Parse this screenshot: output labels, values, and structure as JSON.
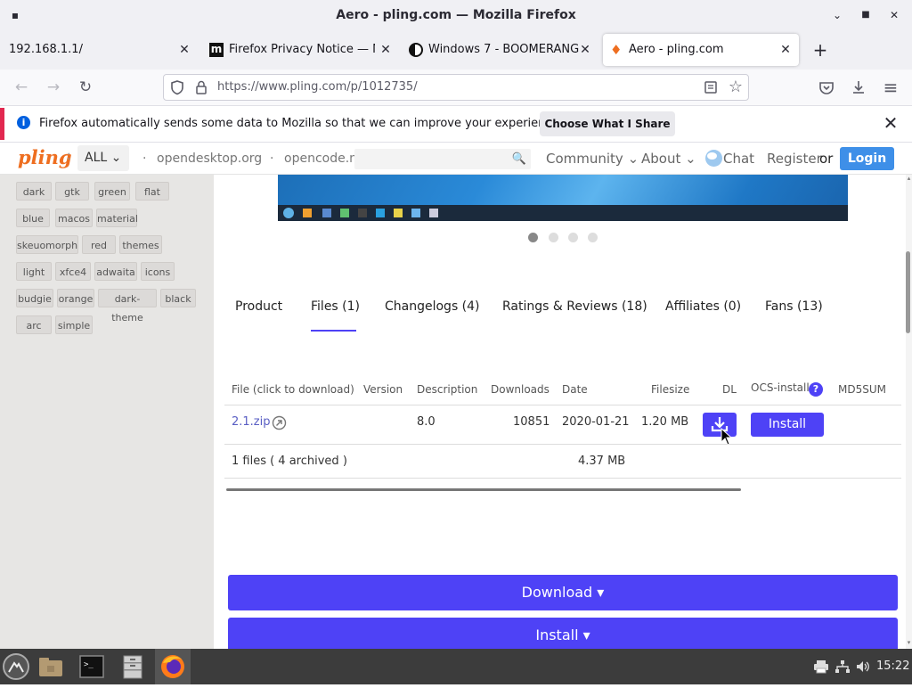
{
  "window": {
    "title": "Aero - pling.com — Mozilla Firefox",
    "min": "▪",
    "max": "▪",
    "close": "✕"
  },
  "tabs": [
    {
      "label": "192.168.1.1/",
      "close": "✕"
    },
    {
      "label": "Firefox Privacy Notice — Mo",
      "icon_text": "m",
      "close": "✕"
    },
    {
      "label": "Windows 7 - BOOMERANG",
      "close": "✕"
    },
    {
      "label": "Aero - pling.com",
      "close": "✕"
    }
  ],
  "new_tab": "+",
  "nav": {
    "back": "←",
    "forward": "→",
    "reload": "↻",
    "url": "https://www.pling.com/p/1012735/",
    "menu": "≡"
  },
  "notification": {
    "text": "Firefox automatically sends some data to Mozilla so that we can improve your experience.",
    "button": "Choose What I Share",
    "close": "✕",
    "info": "i"
  },
  "site_header": {
    "logo": "pling",
    "logo_sep": ":",
    "all": "ALL ⌄",
    "links": [
      "opendesktop.org",
      "opencode.ne"
    ],
    "search_value": "",
    "menu": [
      "Community ⌄",
      "About ⌄",
      "Chat"
    ],
    "register": "Register",
    "or": "or",
    "login": "Login"
  },
  "sidebar": {
    "tags": [
      [
        "dark",
        "gtk",
        "green",
        "flat"
      ],
      [
        "blue",
        "macos",
        "material"
      ],
      [
        "skeuomorph",
        "red",
        "themes"
      ],
      [
        "light",
        "xfce4",
        "adwaita",
        "icons"
      ],
      [
        "budgie",
        "orange",
        "dark-theme",
        "black"
      ],
      [
        "arc",
        "simple"
      ]
    ]
  },
  "product_tabs": [
    "Product",
    "Files (1)",
    "Changelogs (4)",
    "Ratings & Reviews (18)",
    "Affiliates (0)",
    "Fans (13)"
  ],
  "files_table": {
    "headers": [
      "File (click to download)",
      "Version",
      "Description",
      "Downloads",
      "Date",
      "Filesize",
      "DL",
      "OCS-install",
      "MD5SUM"
    ],
    "rows": [
      {
        "file": "2.1.zip",
        "version": "",
        "description": "8.0",
        "downloads": "10851",
        "date": "2020-01-21",
        "filesize": "1.20 MB",
        "install": "Install"
      }
    ],
    "summary": {
      "files": "1 files ( 4 archived )",
      "size": "4.37 MB"
    }
  },
  "actions": {
    "download": "Download ▾",
    "install": "Install ▾"
  },
  "taskbar": {
    "clock": "15:22"
  },
  "colors": {
    "accent": "#4e42f6",
    "login": "#3e8fe8",
    "logo": "#ee6e20"
  }
}
